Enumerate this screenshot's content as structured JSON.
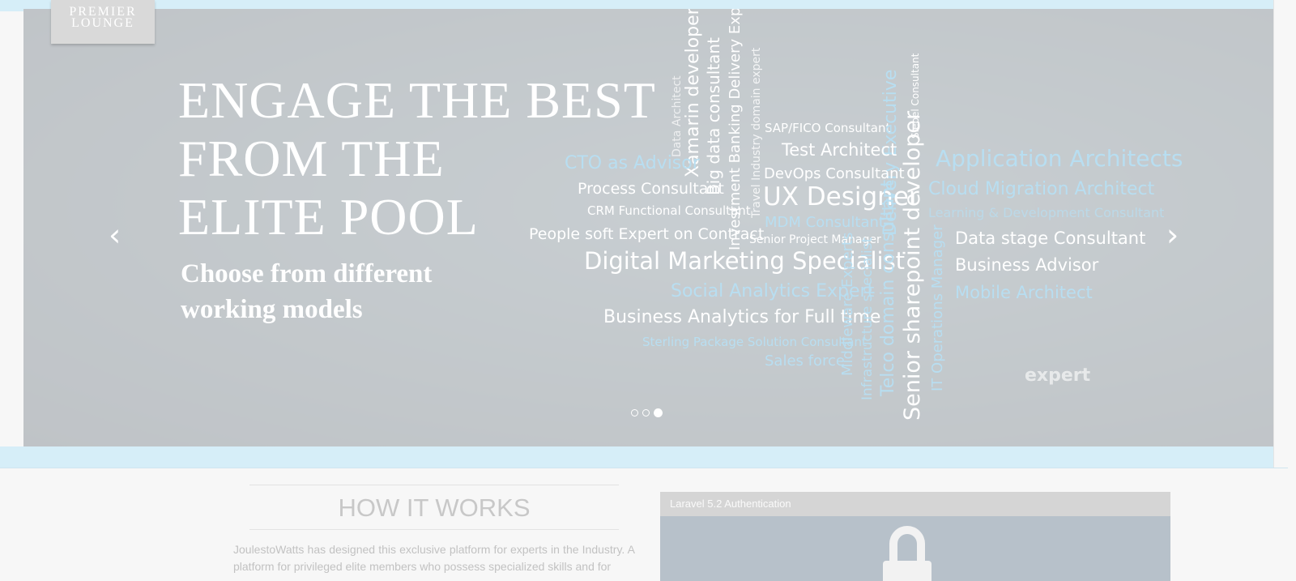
{
  "logo": {
    "line1": "PREMIER",
    "line2": "LOUNGE"
  },
  "slide": {
    "headline_lines": [
      "ENGAGE THE BEST",
      "FROM THE",
      "ELITE POOL"
    ],
    "subline_lines": [
      "Choose from different",
      "working models"
    ]
  },
  "word_cloud": [
    "Data Architect",
    "Xamarin developer",
    "Big data consultant",
    "Investment Banking Delivery Expert",
    "Travel Industry domain expert",
    "SAP/FICO Consultant",
    "Delivery Executive",
    "Siebel Consultant",
    "CTO as Advisor",
    "Test Architect",
    "DevOps Consultant",
    "Application Architects",
    "Process Consultant",
    "UX Designer",
    "Cloud Migration Architect",
    "CRM Functional Consultant",
    "MDM Consultant",
    "Learning & Development Consultant",
    "People soft Expert on Contract",
    "Senior Project Manager",
    "Data stage Consultant",
    "Digital Marketing Specialist",
    "Business Advisor",
    "Social Analytics Expert",
    "Mobile Architect",
    "Business Analytics for Full time",
    "Sterling Package Solution Consultant",
    "Sales force",
    "Middleware Experts",
    "Infrastructure specialist",
    "Telco domain consultant",
    "Senior sharepoint developer",
    "IT Operations Manager",
    "expert"
  ],
  "carousel": {
    "prev_icon": "‹",
    "next_icon": "›",
    "slide_count": 3,
    "active_index": 2
  },
  "how_it_works": {
    "title": "HOW IT WORKS",
    "text": "JoulestoWatts has designed this exclusive platform for experts in the Industry. A platform for privileged elite members who possess specialized skills and for"
  },
  "video": {
    "title": "Laravel 5.2 Authentication"
  },
  "colors": {
    "band": "#d6eef8",
    "cloud_blue": "#b8def1"
  }
}
